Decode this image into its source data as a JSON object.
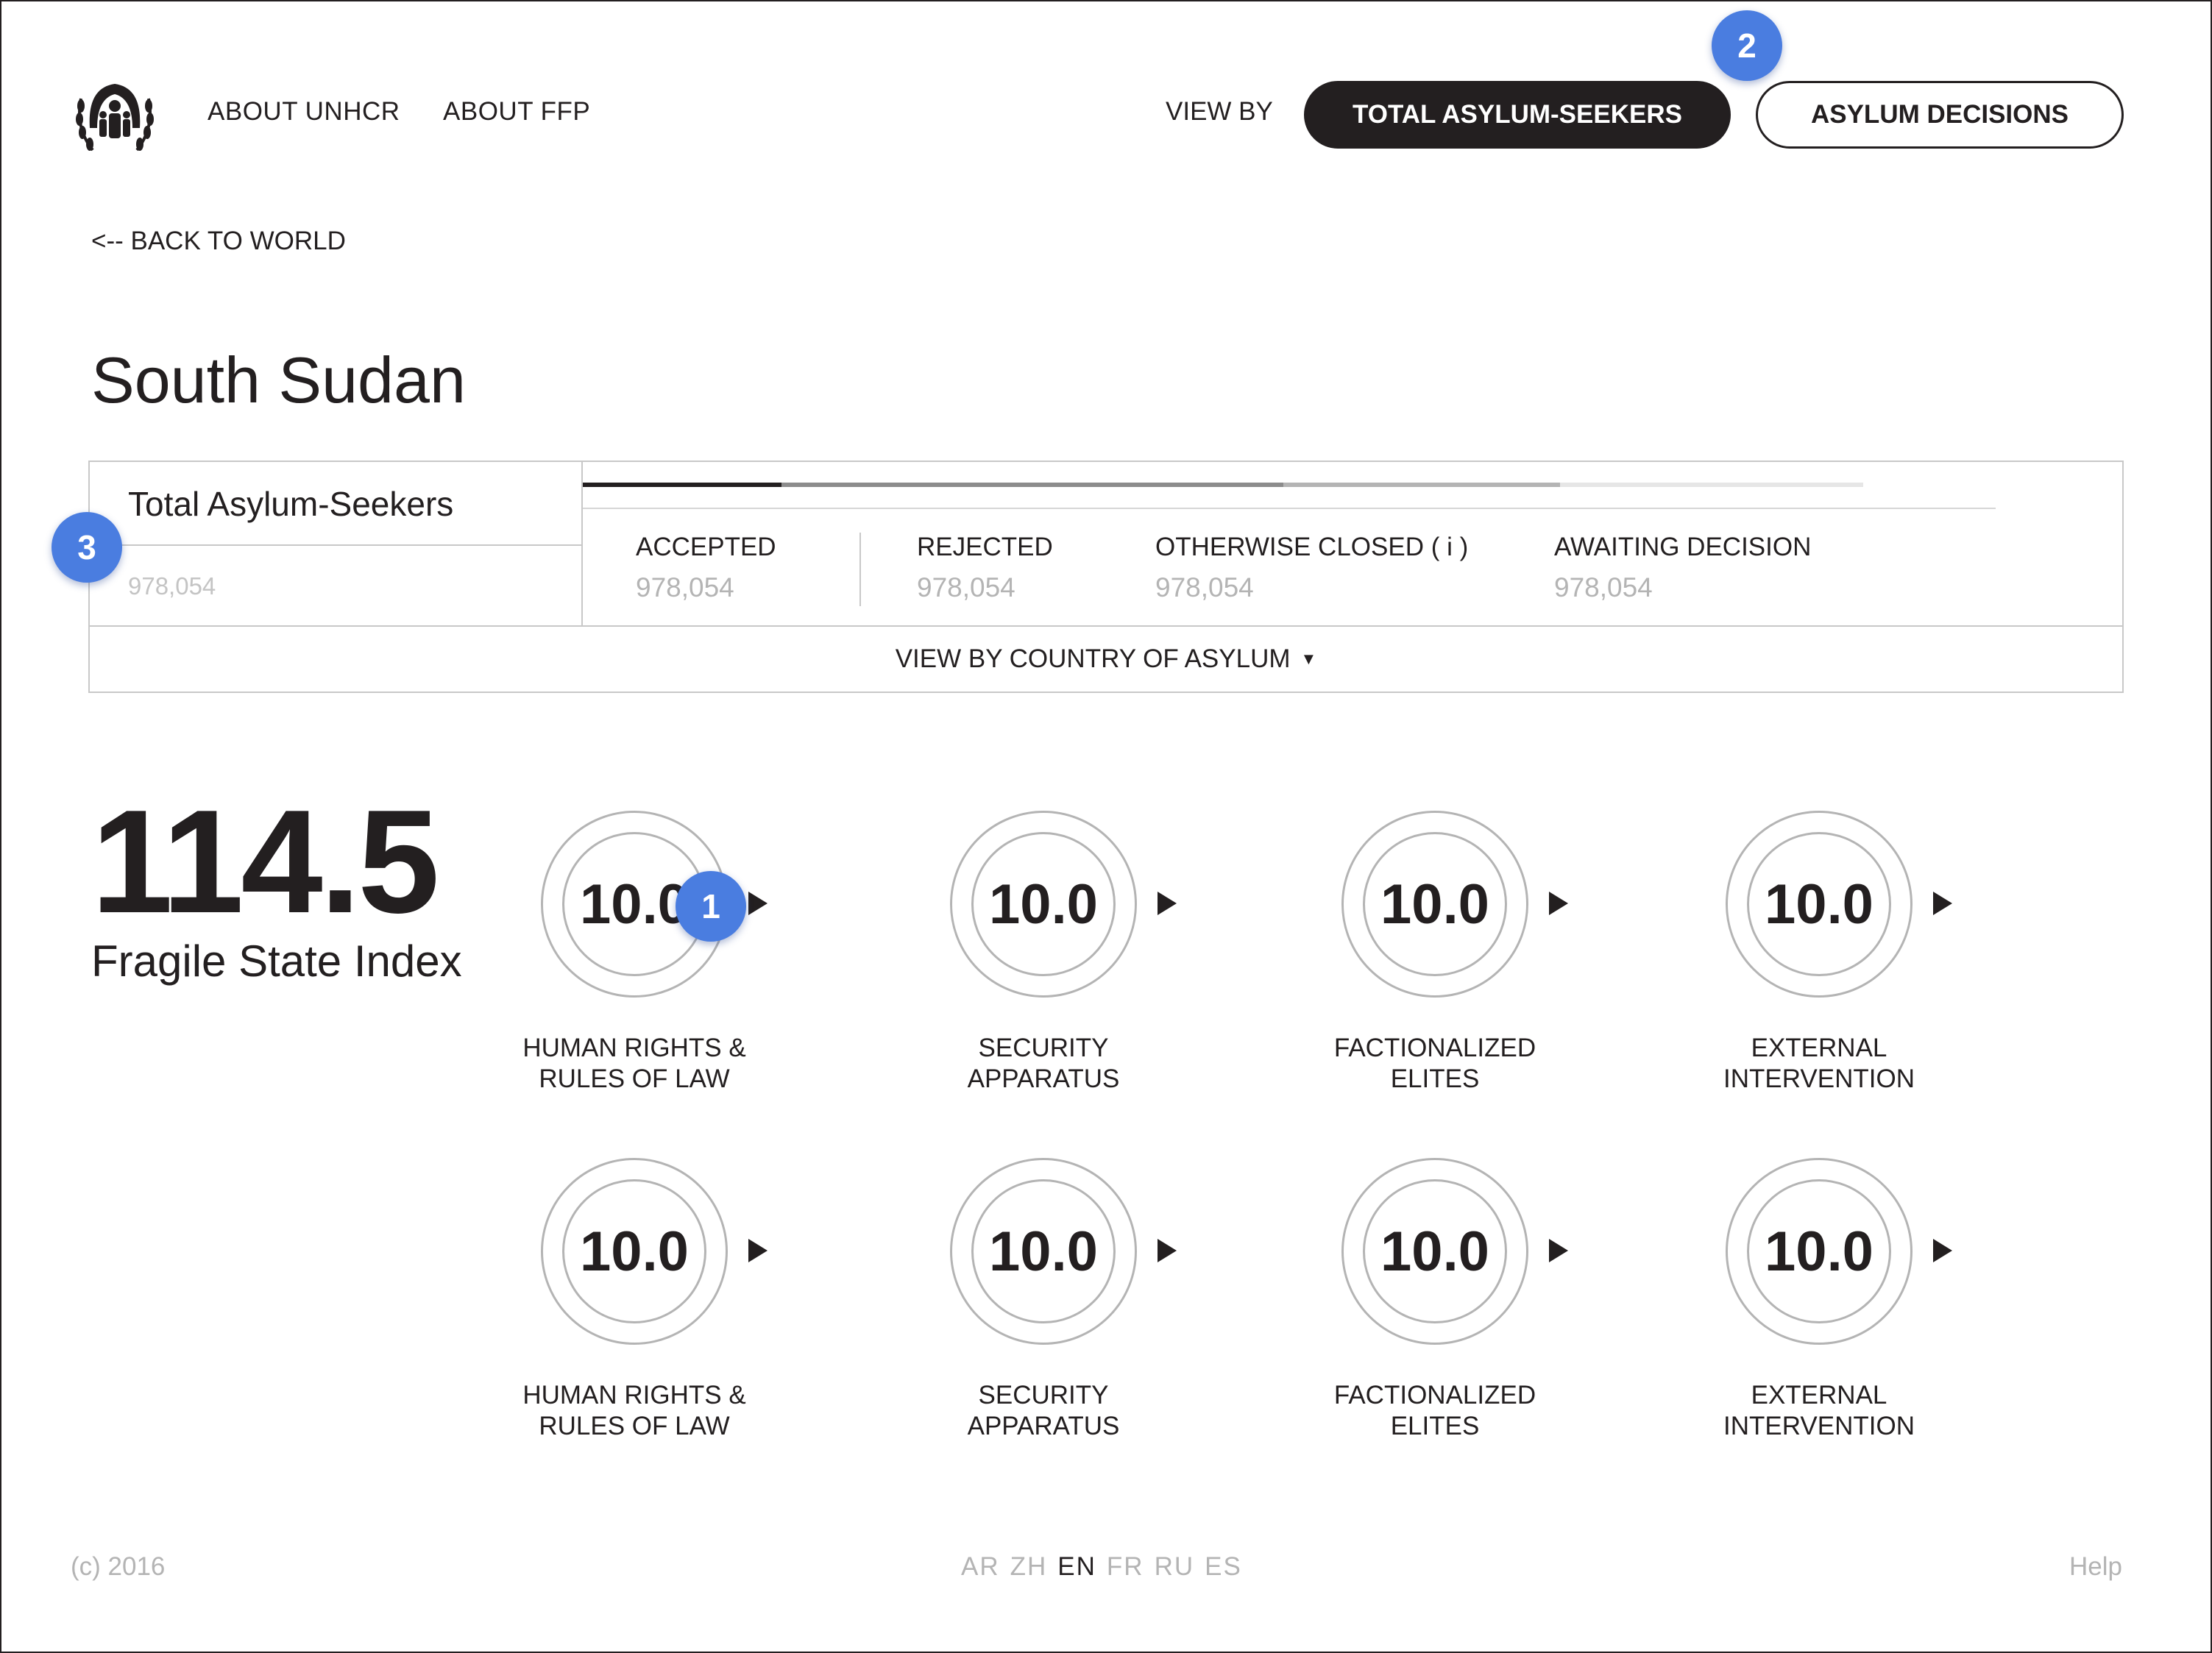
{
  "header": {
    "nav": [
      "ABOUT UNHCR",
      "ABOUT FFP"
    ],
    "view_by_label": "VIEW BY",
    "view_options": [
      "TOTAL ASYLUM-SEEKERS",
      "ASYLUM DECISIONS"
    ],
    "selected_view": "TOTAL ASYLUM-SEEKERS"
  },
  "back_link": "<-- BACK TO WORLD",
  "country": "South Sudan",
  "asylum": {
    "title": "Total Asylum-Seekers",
    "total": "978,054",
    "stats": [
      {
        "label": "ACCEPTED",
        "value": "978,054"
      },
      {
        "label": "REJECTED",
        "value": "978,054"
      },
      {
        "label": "OTHERWISE CLOSED ( i )",
        "value": "978,054"
      },
      {
        "label": "AWAITING DECISION",
        "value": "978,054"
      }
    ],
    "view_by_country": "VIEW BY COUNTRY OF ASYLUM"
  },
  "fsi": {
    "value": "114.5",
    "label": "Fragile State Index",
    "indicators": [
      {
        "value": "10.0",
        "label": "HUMAN RIGHTS &\nRULES OF LAW"
      },
      {
        "value": "10.0",
        "label": "SECURITY\nAPPARATUS"
      },
      {
        "value": "10.0",
        "label": "FACTIONALIZED\nELITES"
      },
      {
        "value": "10.0",
        "label": "EXTERNAL\nINTERVENTION"
      },
      {
        "value": "10.0",
        "label": "HUMAN RIGHTS &\nRULES OF LAW"
      },
      {
        "value": "10.0",
        "label": "SECURITY\nAPPARATUS"
      },
      {
        "value": "10.0",
        "label": "FACTIONALIZED\nELITES"
      },
      {
        "value": "10.0",
        "label": "EXTERNAL\nINTERVENTION"
      }
    ]
  },
  "markers": [
    "1",
    "2",
    "3"
  ],
  "footer": {
    "copyright": "(c) 2016",
    "languages": [
      "AR",
      "ZH",
      "EN",
      "FR",
      "RU",
      "ES"
    ],
    "active_language": "EN",
    "help": "Help"
  },
  "colors": {
    "text": "#231f20",
    "muted": "#b4b4b4",
    "border": "#c8c8c8",
    "marker": "#4a7de0"
  }
}
